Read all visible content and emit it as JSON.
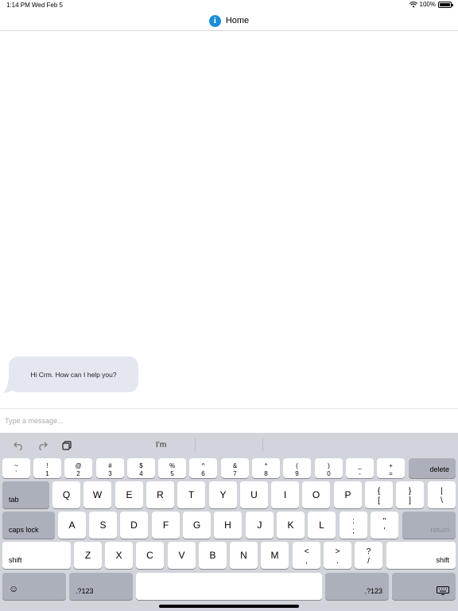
{
  "status": {
    "time": "1:14 PM",
    "date": "Wed Feb 5",
    "battery": "100%"
  },
  "nav": {
    "title": "Home",
    "icon": "info-icon"
  },
  "chat": {
    "messages": [
      {
        "from": "bot",
        "text": "Hi Crm. How can I help you?"
      }
    ]
  },
  "composer": {
    "placeholder": "Type a message...",
    "value": ""
  },
  "keyboard": {
    "suggestion": "I’m",
    "number_row": [
      {
        "top": "~",
        "bottom": "`"
      },
      {
        "top": "!",
        "bottom": "1"
      },
      {
        "top": "@",
        "bottom": "2"
      },
      {
        "top": "#",
        "bottom": "3"
      },
      {
        "top": "$",
        "bottom": "4"
      },
      {
        "top": "%",
        "bottom": "5"
      },
      {
        "top": "^",
        "bottom": "6"
      },
      {
        "top": "&",
        "bottom": "7"
      },
      {
        "top": "*",
        "bottom": "8"
      },
      {
        "top": "(",
        "bottom": "9"
      },
      {
        "top": ")",
        "bottom": "0"
      },
      {
        "top": "_",
        "bottom": "-"
      },
      {
        "top": "+",
        "bottom": "="
      }
    ],
    "delete": "delete",
    "tab": "tab",
    "row_q": [
      "Q",
      "W",
      "E",
      "R",
      "T",
      "Y",
      "U",
      "I",
      "O",
      "P"
    ],
    "row_q_extra": [
      {
        "top": "{",
        "bottom": "["
      },
      {
        "top": "}",
        "bottom": "]"
      },
      {
        "top": "|",
        "bottom": "\\"
      }
    ],
    "caps_lock": "caps lock",
    "row_a": [
      "A",
      "S",
      "D",
      "F",
      "G",
      "H",
      "J",
      "K",
      "L"
    ],
    "row_a_extra": [
      {
        "top": ":",
        "bottom": ";"
      },
      {
        "top": "\"",
        "bottom": "'"
      }
    ],
    "return": "return",
    "shift": "shift",
    "row_z": [
      "Z",
      "X",
      "C",
      "V",
      "B",
      "N",
      "M"
    ],
    "row_z_extra": [
      {
        "top": "<",
        "bottom": ","
      },
      {
        "top": ">",
        "bottom": "."
      },
      {
        "top": "?",
        "bottom": "/"
      }
    ],
    "emoji": "☺",
    "numbers": ".?123",
    "colors": {
      "background": "#d1d4da",
      "key": "#ffffff",
      "dark_key": "#abb0ba"
    }
  }
}
